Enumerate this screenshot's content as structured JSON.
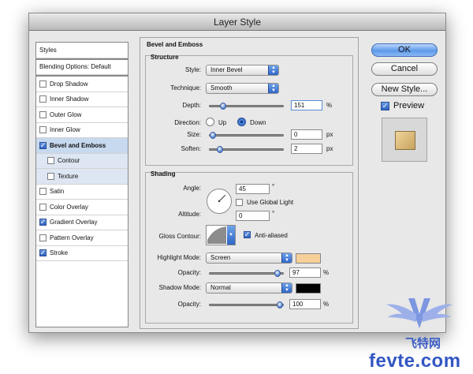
{
  "window": {
    "title": "Layer Style"
  },
  "styles_panel": {
    "header": "Styles",
    "blending_options": "Blending Options: Default",
    "items": [
      {
        "label": "Drop Shadow",
        "checked": false
      },
      {
        "label": "Inner Shadow",
        "checked": false
      },
      {
        "label": "Outer Glow",
        "checked": false
      },
      {
        "label": "Inner Glow",
        "checked": false
      },
      {
        "label": "Bevel and Emboss",
        "checked": true,
        "selected": true
      },
      {
        "label": "Contour",
        "checked": false,
        "sub": true
      },
      {
        "label": "Texture",
        "checked": false,
        "sub": true
      },
      {
        "label": "Satin",
        "checked": false
      },
      {
        "label": "Color Overlay",
        "checked": false
      },
      {
        "label": "Gradient Overlay",
        "checked": true
      },
      {
        "label": "Pattern Overlay",
        "checked": false
      },
      {
        "label": "Stroke",
        "checked": true
      }
    ]
  },
  "bevel": {
    "title": "Bevel and Emboss",
    "structure_title": "Structure",
    "style_label": "Style:",
    "style_value": "Inner Bevel",
    "technique_label": "Technique:",
    "technique_value": "Smooth",
    "depth_label": "Depth:",
    "depth_value": "151",
    "depth_unit": "%",
    "depth_level": 0.15,
    "direction_label": "Direction:",
    "dir_up": "Up",
    "dir_down": "Down",
    "direction": "Down",
    "size_label": "Size:",
    "size_value": "0",
    "size_unit": "px",
    "size_level": 0.0,
    "soften_label": "Soften:",
    "soften_value": "2",
    "soften_unit": "px",
    "soften_level": 0.1
  },
  "shading": {
    "title": "Shading",
    "angle_label": "Angle:",
    "angle_value": "45",
    "angle_unit": "°",
    "global_light_label": "Use Global Light",
    "global_light": false,
    "altitude_label": "Altitude:",
    "altitude_value": "0",
    "altitude_unit": "°",
    "gloss_label": "Gloss Contour:",
    "anti_aliased_label": "Anti-aliased",
    "anti_aliased": true,
    "highlight_label": "Highlight Mode:",
    "highlight_value": "Screen",
    "highlight_color": "#f7cf99",
    "opacity_label": "Opacity:",
    "highlight_opacity": "97",
    "opacity_unit": "%",
    "highlight_level": 0.97,
    "shadow_label": "Shadow Mode:",
    "shadow_value": "Normal",
    "shadow_color": "#000000",
    "shadow_opacity_label": "Opacity:",
    "shadow_opacity": "100",
    "shadow_unit": "%",
    "shadow_level": 1.0
  },
  "buttons": {
    "ok": "OK",
    "cancel": "Cancel",
    "new_style": "New Style...",
    "preview": "Preview",
    "preview_checked": true
  },
  "watermark": {
    "chinese": "飞特网",
    "url": "fevte.com"
  },
  "colors": {
    "accent": "#3a72d4",
    "selected_row": "#c7d9ef",
    "sub_row": "#dde6f2"
  }
}
